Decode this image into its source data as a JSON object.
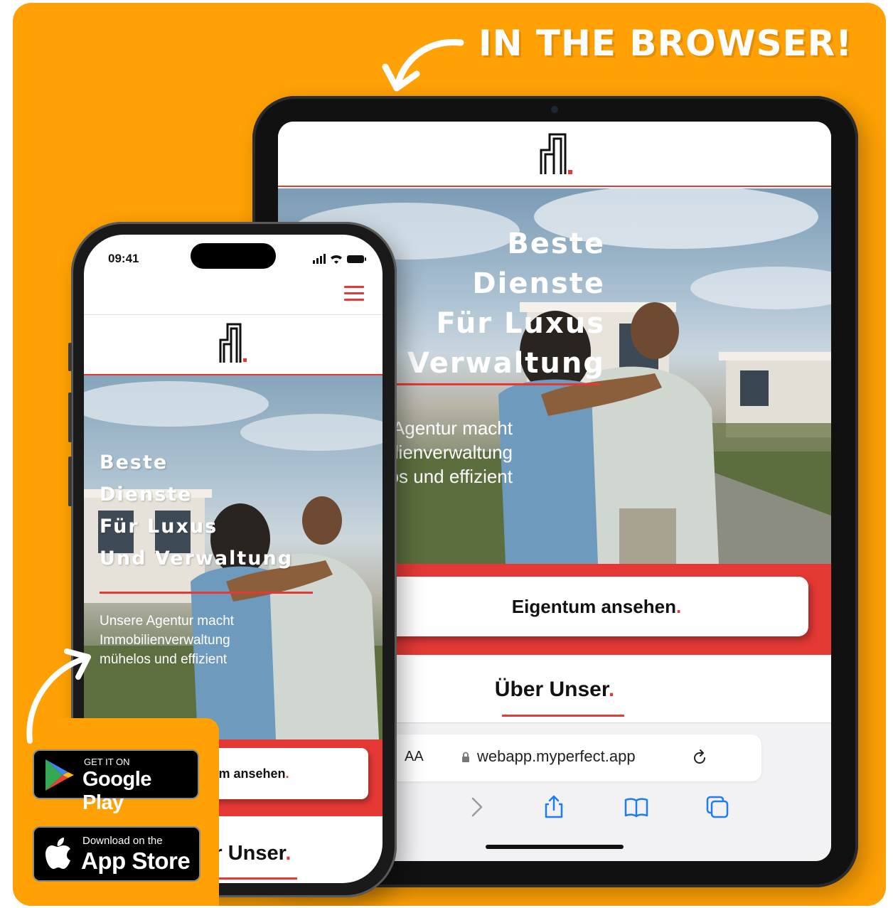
{
  "promo": {
    "headline": "IN THE BROWSER!",
    "colors": {
      "background": "#FFA105",
      "accent": "#E53935"
    }
  },
  "tablet": {
    "hero": {
      "title_lines": [
        "Beste",
        "Dienste",
        "Für Luxus",
        "Und Verwaltung"
      ],
      "subtitle_lines": [
        "Unsere Agentur macht",
        "Immobilienverwaltung",
        "mühelos und effizient"
      ]
    },
    "cta_label": "Eigentum ansehen",
    "cta_dot": ".",
    "about_label": "Über Unser",
    "about_dot": ".",
    "browser": {
      "text_size_label": "AA",
      "url": "webapp.myperfect.app",
      "icons": [
        "lock-icon",
        "reload-icon",
        "forward-icon",
        "share-icon",
        "bookmarks-icon",
        "tabs-icon"
      ]
    }
  },
  "phone": {
    "status_time": "09:41",
    "hero": {
      "title_lines": [
        "Beste",
        "Dienste",
        "Für Luxus",
        "Und Verwaltung"
      ],
      "subtitle_lines": [
        "Unsere Agentur macht",
        "Immobilienverwaltung",
        "mühelos und effizient"
      ]
    },
    "cta_label": "Eigentum ansehen",
    "cta_dot": ".",
    "about_label": "Über Unser",
    "about_dot": "."
  },
  "badges": {
    "google_play": {
      "small": "GET IT ON",
      "big": "Google Play"
    },
    "app_store": {
      "small": "Download on the",
      "big": "App Store"
    }
  }
}
